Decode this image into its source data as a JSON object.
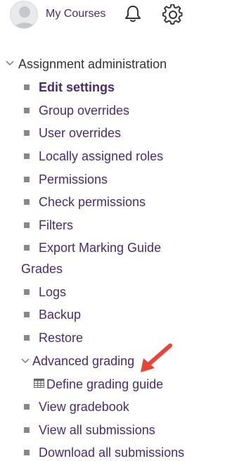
{
  "header": {
    "my_courses_label": "My Courses",
    "avatar_icon": "user-avatar",
    "bell_icon": "bell-icon",
    "gear_icon": "gear-icon"
  },
  "nav": {
    "section_label": "Assignment administration",
    "items": [
      {
        "label": "Edit settings"
      },
      {
        "label": "Group overrides"
      },
      {
        "label": "User overrides"
      },
      {
        "label": "Locally assigned roles"
      },
      {
        "label": "Permissions"
      },
      {
        "label": "Check permissions"
      },
      {
        "label": "Filters"
      },
      {
        "label_line1": "Export Marking Guide",
        "label_line2": "Grades"
      },
      {
        "label": "Logs"
      },
      {
        "label": "Backup"
      },
      {
        "label": "Restore"
      }
    ],
    "advanced": {
      "label": "Advanced grading",
      "child": {
        "label": "Define grading guide",
        "icon": "grid-table-icon"
      }
    },
    "items_after": [
      {
        "label": "View gradebook"
      },
      {
        "label": "View all submissions"
      },
      {
        "label": "Download all submissions"
      }
    ]
  },
  "colors": {
    "link": "#4b2a72",
    "text": "#333333",
    "bullet": "#888888",
    "arrow": "#e8443a"
  }
}
